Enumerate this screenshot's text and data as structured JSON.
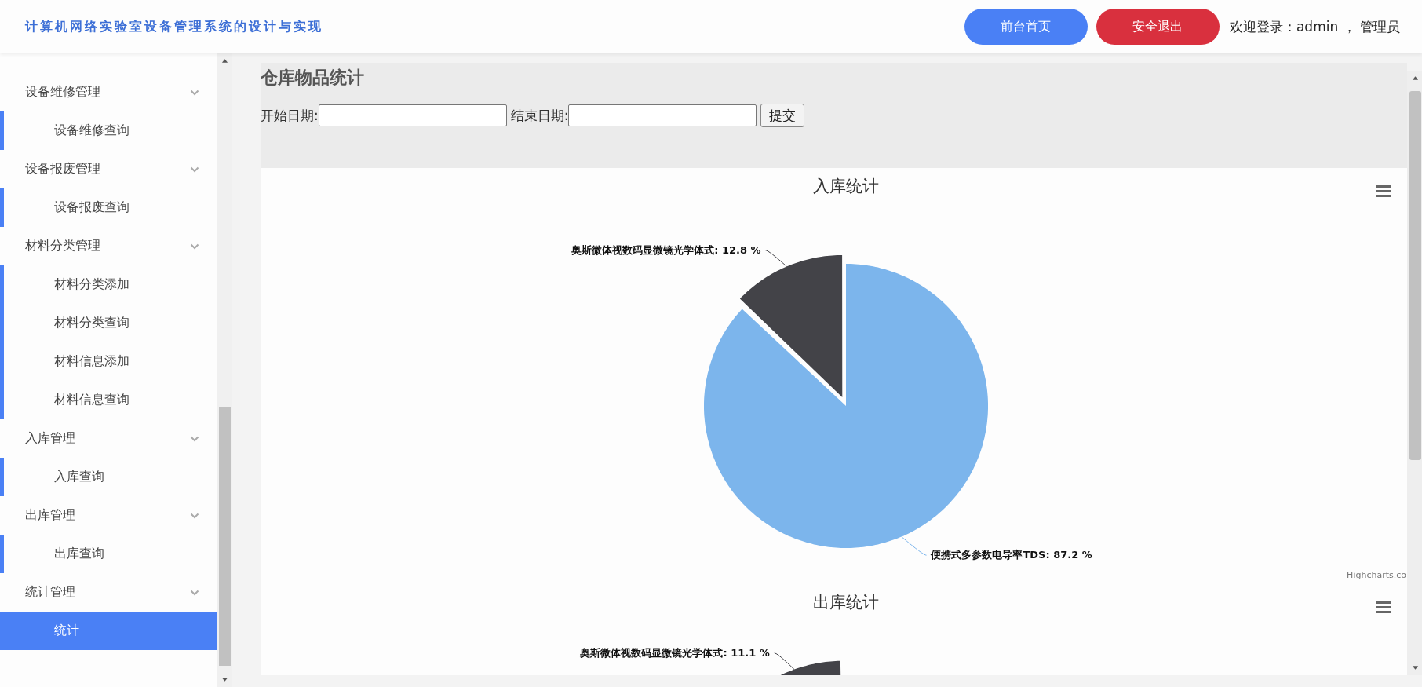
{
  "header": {
    "title": "计算机网络实验室设备管理系统的设计与实现",
    "buttons": [
      {
        "label": "前台首页",
        "kind": "primary"
      },
      {
        "label": "安全退出",
        "kind": "danger"
      }
    ],
    "welcome": "欢迎登录：admin ， 管理员"
  },
  "sidebar": {
    "groups": [
      {
        "label": "设备维修管理",
        "expanded": true,
        "children": [
          {
            "label": "设备维修查询",
            "selected": false
          }
        ]
      },
      {
        "label": "设备报废管理",
        "expanded": true,
        "children": [
          {
            "label": "设备报废查询",
            "selected": false
          }
        ]
      },
      {
        "label": "材料分类管理",
        "expanded": true,
        "children": [
          {
            "label": "材料分类添加",
            "selected": false
          },
          {
            "label": "材料分类查询",
            "selected": false
          },
          {
            "label": "材料信息添加",
            "selected": false
          },
          {
            "label": "材料信息查询",
            "selected": false
          }
        ]
      },
      {
        "label": "入库管理",
        "expanded": true,
        "children": [
          {
            "label": "入库查询",
            "selected": false
          }
        ]
      },
      {
        "label": "出库管理",
        "expanded": true,
        "children": [
          {
            "label": "出库查询",
            "selected": false
          }
        ]
      },
      {
        "label": "统计管理",
        "expanded": true,
        "children": [
          {
            "label": "统计",
            "selected": true
          }
        ]
      }
    ]
  },
  "page": {
    "title": "仓库物品统计",
    "filters": [
      {
        "label": "开始日期:"
      },
      {
        "label": "结束日期:"
      }
    ],
    "submit": "提交"
  },
  "charts": [
    {
      "credit": "Highcharts.co",
      "chart_data": {
        "type": "pie",
        "title": "入库统计",
        "values": [
          87.2,
          12.8
        ],
        "colors": [
          "#7cb5ec",
          "#434348"
        ],
        "value_labels": [
          "便携式多参数电导率TDS: 87.2 %",
          "奥斯微体视数码显微镜光学体式: 12.8 %"
        ]
      }
    },
    {
      "chart_data": {
        "type": "pie",
        "title": "出库统计",
        "values": [
          11.1
        ],
        "colors": [
          "#434348"
        ],
        "value_labels": [
          "奥斯微体视数码显微镜光学体式: 11.1 %"
        ]
      }
    }
  ]
}
